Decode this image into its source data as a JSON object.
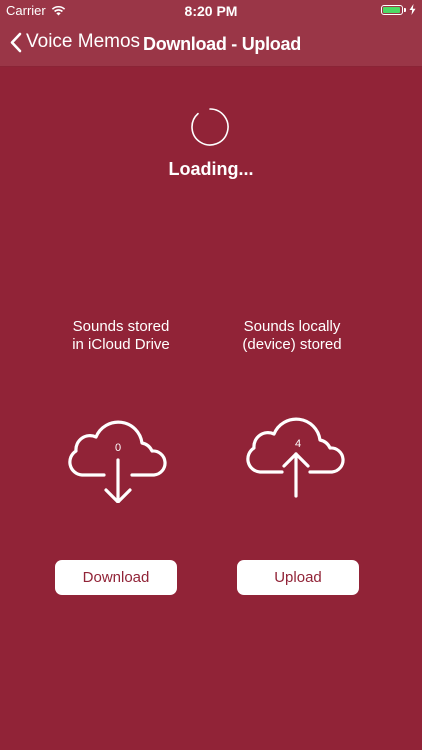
{
  "status_bar": {
    "carrier": "Carrier",
    "time": "8:20 PM"
  },
  "nav": {
    "back_label": "Voice Memos",
    "title": "Download - Upload"
  },
  "loading": {
    "text": "Loading..."
  },
  "download_section": {
    "label_line1": "Sounds stored",
    "label_line2": "in iCloud Drive",
    "count": "0",
    "icon": "cloud-download-icon",
    "button_label": "Download"
  },
  "upload_section": {
    "label_line1": "Sounds locally",
    "label_line2": "(device) stored",
    "count": "4",
    "icon": "cloud-upload-icon",
    "button_label": "Upload"
  },
  "colors": {
    "background": "#912337",
    "nav": "#9a3647",
    "button_text": "#912337",
    "battery": "#4cd964"
  }
}
